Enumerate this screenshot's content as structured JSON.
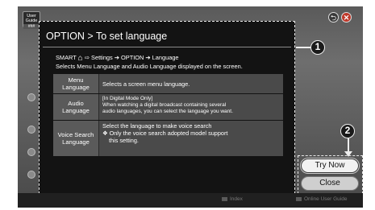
{
  "app": {
    "badge_label": "User Guide",
    "badge_sub": "###"
  },
  "panel": {
    "title": "OPTION > To set language",
    "nav_prefix": "SMART",
    "nav_rest": "⇨ Settings ➔ OPTION ➔ Language",
    "description": "Selects Menu Language and Audio Language displayed on the screen."
  },
  "rows": [
    {
      "label_line1": "Menu",
      "label_line2": "Language",
      "desc_line1": "Selects a screen menu language.",
      "desc_line2": "",
      "desc_line3": ""
    },
    {
      "label_line1": "Audio",
      "label_line2": "Language",
      "desc_line1": "[In Digital Mode Only]",
      "desc_line2": "When watching a digital broadcast containing several",
      "desc_line3": "audio languages, you can select the language you want."
    },
    {
      "label_line1": "Voice Search",
      "label_line2": "Language",
      "desc_line1": "Select the language to make voice search",
      "desc_line2": "❖ Only the voice search adopted model support",
      "desc_line3": "this setting."
    }
  ],
  "callouts": {
    "one": "1",
    "two": "2"
  },
  "buttons": {
    "try_now": "Try Now",
    "close": "Close"
  },
  "footer": {
    "index": "Index",
    "online_guide": "Online User Guide"
  },
  "icons": {
    "back": "⮌",
    "close": "✕",
    "home": "⌂"
  }
}
